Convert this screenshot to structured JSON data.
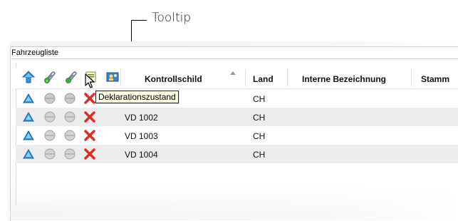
{
  "annotation": {
    "label": "Tooltip"
  },
  "group": {
    "title": "Fahrzeugliste"
  },
  "columns": [
    {
      "key": "col_up",
      "icon": "blue-up-triangle-icon"
    },
    {
      "key": "col_green1",
      "icon": "paperclip-green-icon"
    },
    {
      "key": "col_green2",
      "icon": "paperclip-green-icon"
    },
    {
      "key": "col_declaration",
      "icon": "declaration-status-icon"
    },
    {
      "key": "col_user",
      "icon": "user-group-icon"
    },
    {
      "key": "kontrollschild",
      "label": "Kontrollschild",
      "sorted": "ascending"
    },
    {
      "key": "land",
      "label": "Land"
    },
    {
      "key": "interne",
      "label": "Interne Bezeichnung"
    },
    {
      "key": "stamm",
      "label": "Stamm"
    }
  ],
  "rows": [
    {
      "kontrollschild": "",
      "land": "CH"
    },
    {
      "kontrollschild": "VD 1002",
      "land": "CH"
    },
    {
      "kontrollschild": "VD 1003",
      "land": "CH"
    },
    {
      "kontrollschild": "VD 1004",
      "land": "CH"
    }
  ],
  "tooltip": {
    "text": "Deklarationszustand"
  },
  "colors": {
    "accent_blue": "#2f8fe0",
    "status_red": "#e02a2a",
    "alt_row": "#ececec",
    "tooltip_bg": "#fdfde8"
  }
}
